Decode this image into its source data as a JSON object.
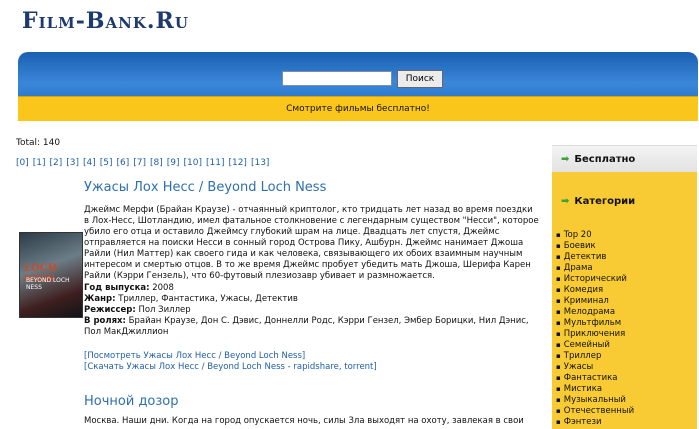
{
  "site": {
    "logo": "Film-Bank.Ru"
  },
  "search": {
    "button": "Поиск",
    "placeholder": ""
  },
  "banner": "Смотрите фильмы бесплатно!",
  "total": "Total: 140",
  "pager": [
    "[0]",
    "[1]",
    "[2]",
    "[3]",
    "[4]",
    "[5]",
    "[6]",
    "[7]",
    "[8]",
    "[9]",
    "[10]",
    "[11]",
    "[12]",
    "[13]"
  ],
  "movie1": {
    "title": "Ужасы Лох Несс / Beyond Loch Ness",
    "poster_text_1": "LOCH NESS",
    "poster_text_2": "BEYOND LOCH NESS",
    "desc": "Джеймс Мерфи (Брайан Краузе) - отчаянный криптолог, кто тридцать лет назад во время поездки в Лох-Несс, Шотландию, имел фатальное столкновение с легендарным существом \"Несси\", которое убило его отца и оставило Джеймсу глубокий шрам на лице. Двадцать лет спустя, Джеймс отправляется на поиски Несси в сонный город Острова Пику, Ашбурн. Джеймс нанимает Джоша Райли (Нил Маттер) как своего гида и как человека, связывающего их обоих взаимным научным интересом и смертью отцов. В то же время Джеймс пробует убедить мать Джоша, Шерифа Карен Райли (Кэрри Гензель), что 60-футовый плезиозавр убивает и размножается.",
    "year_label": "Год выпуска:",
    "year": "2008",
    "genre_label": "Жанр:",
    "genre": "Триллер, Фантастика, Ужасы, Детектив",
    "director_label": "Режиссер:",
    "director": "Пол Зиллер",
    "cast_label": "В ролях:",
    "cast": "Брайан Краузе, Дон С. Дэвис, Доннелли Родс, Кэрри Гензел, Эмбер Борицки, Нил Дэнис, Пол МакДжиллион",
    "link_watch": "Посмотреть Ужасы Лох Несс / Beyond Loch Ness",
    "link_download": "Скачать Ужасы Лох Несс / Beyond Loch Ness - rapidshare, torrent"
  },
  "movie2": {
    "title": "Ночной дозор",
    "desc": "Москва. Наши дни. Когда на город опускается ночь, силы Зла выходят на охоту, завлекая в свои"
  },
  "sidebar": {
    "free_label": "Бесплатно",
    "categories_label": "Категории",
    "categories": [
      "Top 20",
      "Боевик",
      "Детектив",
      "Драма",
      "Исторический",
      "Комедия",
      "Криминал",
      "Мелодрама",
      "Мультфильм",
      "Приключения",
      "Семейный",
      "Триллер",
      "Ужасы",
      "Фантастика",
      "Мистика",
      "Музыкальный",
      "Отечественный",
      "Фэнтези"
    ]
  }
}
